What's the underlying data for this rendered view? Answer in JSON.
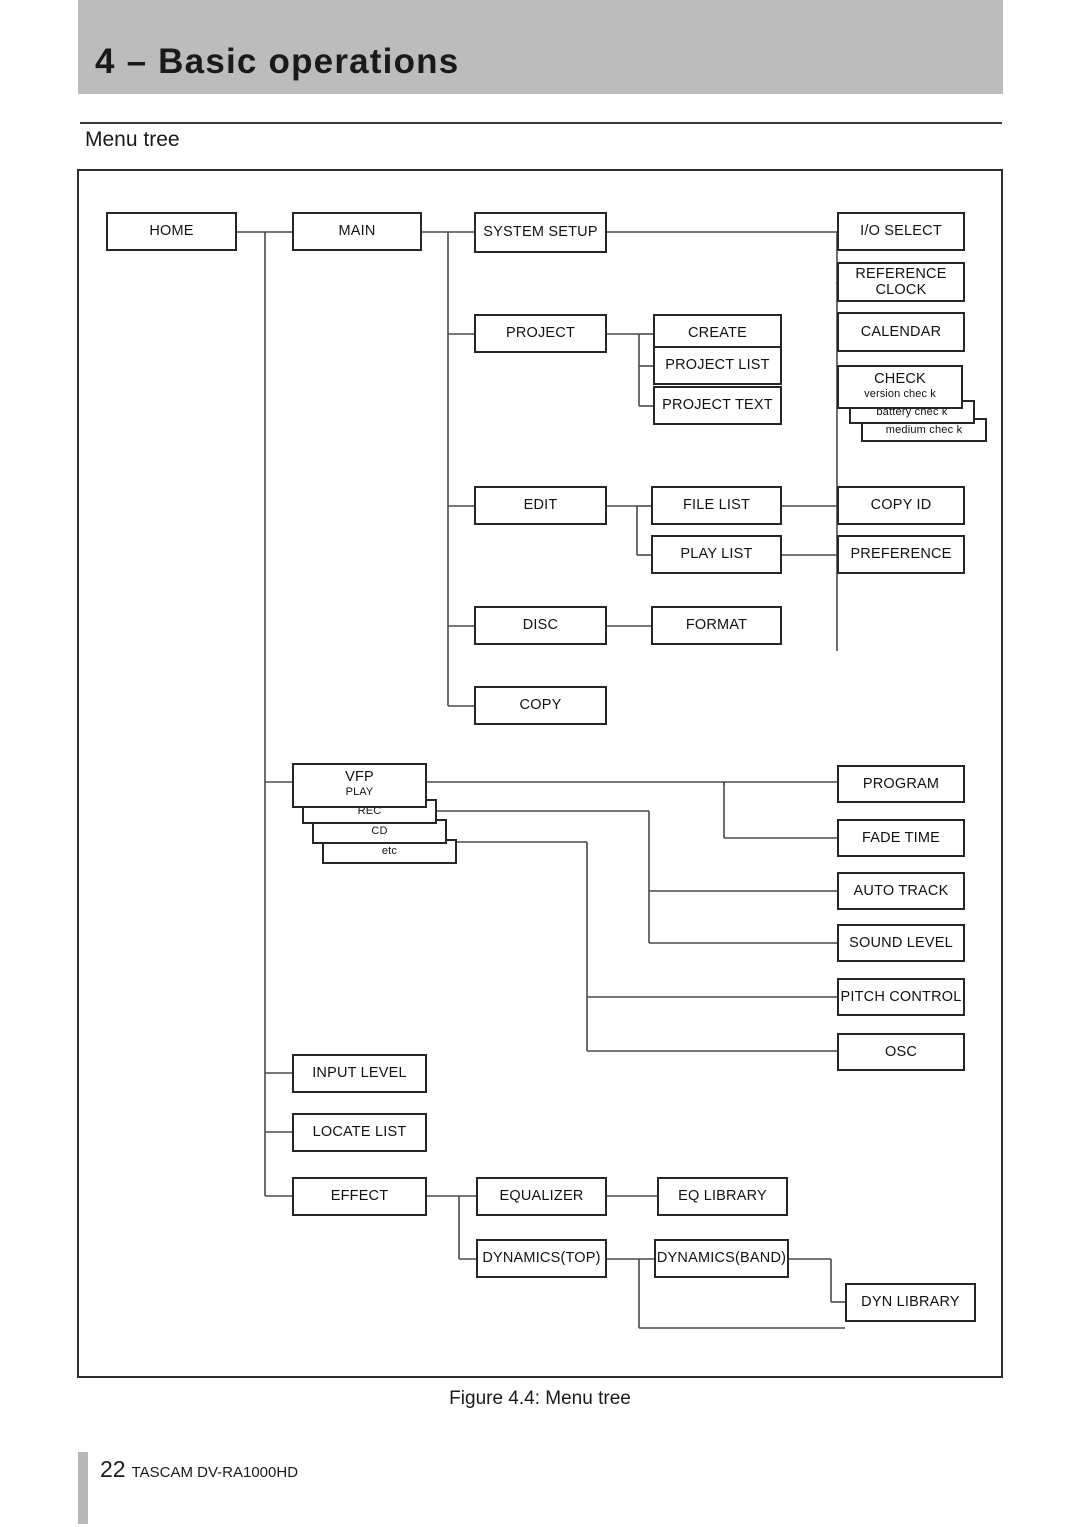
{
  "page": {
    "chapter_title": "4 – Basic operations",
    "section_title": "Menu tree",
    "figure_caption": "Figure 4.4: Menu tree",
    "footer_page_number": "22",
    "footer_model": "TASCAM  DV-RA1000HD",
    "header_band_color": "#bcbcbc",
    "node_border_color": "#262626",
    "wire_color": "#4a4a4a"
  },
  "diagram": {
    "type": "menu-tree",
    "nodes": {
      "home": "HOME",
      "main": "MAIN",
      "system_setup": "SYSTEM SETUP",
      "project": "PROJECT",
      "edit": "EDIT",
      "disc": "DISC",
      "copy": "COPY",
      "create": "CREATE",
      "project_list": "PROJECT LIST",
      "project_text": "PROJECT TEXT",
      "file_list": "FILE LIST",
      "play_list": "PLAY LIST",
      "format": "FORMAT",
      "io_select": "I/O SELECT",
      "reference_clock": "REFERENCE\nCLOCK",
      "calendar": "CALENDAR",
      "check": "CHECK",
      "check_version": "version chec k",
      "check_battery": "battery chec k",
      "check_medium": "medium chec k",
      "copy_id": "COPY ID",
      "preference": "PREFERENCE",
      "vfp": "VFP",
      "vfp_play": "PLAY",
      "vfp_rec": "REC",
      "vfp_cd": "CD",
      "vfp_etc": "etc",
      "program": "PROGRAM",
      "fade_time": "FADE TIME",
      "auto_track": "AUTO TRACK",
      "sound_level": "SOUND LEVEL",
      "pitch_control": "PITCH CONTROL",
      "osc": "OSC",
      "input_level": "INPUT LEVEL",
      "locate_list": "LOCATE LIST",
      "effect": "EFFECT",
      "equalizer": "EQUALIZER",
      "eq_library": "EQ LIBRARY",
      "dynamics_top": "DYNAMICS(TOP)",
      "dynamics_band": "DYNAMICS(BAND)",
      "dyn_library": "DYN LIBRARY"
    }
  }
}
